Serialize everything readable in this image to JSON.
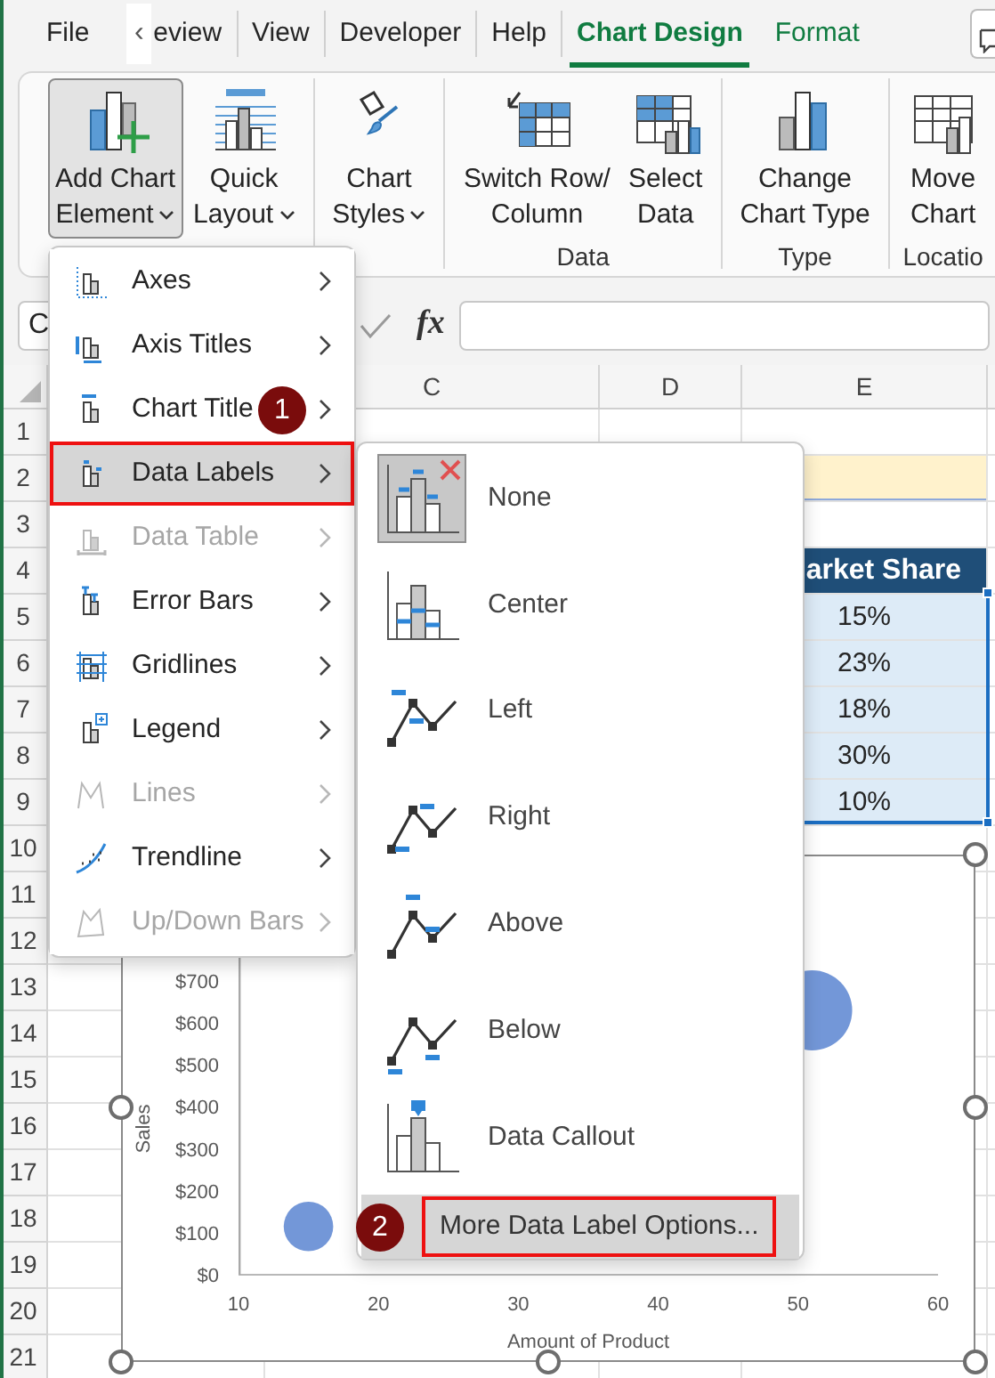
{
  "ribbon_tabs": [
    {
      "label": "File",
      "selected": false,
      "contextual": false
    },
    {
      "label": "eview",
      "selected": false,
      "contextual": false
    },
    {
      "label": "View",
      "selected": false,
      "contextual": false
    },
    {
      "label": "Developer",
      "selected": false,
      "contextual": false
    },
    {
      "label": "Help",
      "selected": false,
      "contextual": false
    },
    {
      "label": "Chart Design",
      "selected": true,
      "contextual": true
    },
    {
      "label": "Format",
      "selected": false,
      "contextual": true
    }
  ],
  "tab_scroll_button": "‹",
  "ribbon_groups": [
    {
      "buttons": [
        {
          "lines": [
            "Add Chart",
            "Element"
          ],
          "dropdown": true,
          "pressed": true
        },
        {
          "lines": [
            "Quick",
            "Layout"
          ],
          "dropdown": true,
          "pressed": false
        }
      ]
    },
    {
      "buttons": [
        {
          "lines": [
            "Chart",
            "Styles"
          ],
          "dropdown": true,
          "pressed": false
        }
      ]
    },
    {
      "label": "Data",
      "buttons": [
        {
          "lines": [
            "Switch Row/",
            "Column"
          ],
          "dropdown": false,
          "pressed": false
        },
        {
          "lines": [
            "Select",
            "Data"
          ],
          "dropdown": false,
          "pressed": false
        }
      ]
    },
    {
      "label": "Type",
      "buttons": [
        {
          "lines": [
            "Change",
            "Chart Type"
          ],
          "dropdown": false,
          "pressed": false
        }
      ]
    },
    {
      "label": "Locatio",
      "buttons": [
        {
          "lines": [
            "Move",
            "Chart"
          ],
          "dropdown": false,
          "pressed": false
        }
      ]
    }
  ],
  "formula_bar": {
    "name_box": "C",
    "function_label": "fx"
  },
  "sheet": {
    "columns": [
      "C",
      "D",
      "E"
    ],
    "rows": [
      "1",
      "2",
      "3",
      "4",
      "5",
      "6",
      "7",
      "8",
      "9",
      "10",
      "11",
      "12",
      "13",
      "14",
      "15",
      "16",
      "17",
      "18",
      "19",
      "20",
      "21"
    ]
  },
  "table": {
    "header": "arket Share",
    "values": [
      "15%",
      "23%",
      "18%",
      "30%",
      "10%"
    ]
  },
  "chart": {
    "chart_data": {
      "type": "scatter",
      "xlabel": "Amount of Product",
      "ylabel": "Sales",
      "x": [
        15,
        51
      ],
      "values": [
        115,
        630
      ],
      "xlim": [
        10,
        60
      ],
      "ylim": [
        0,
        800
      ],
      "xticks": [
        10,
        20,
        30,
        40,
        50,
        60
      ],
      "yticks": [
        {
          "value": 0,
          "label": "$0"
        },
        {
          "value": 100,
          "label": "$100"
        },
        {
          "value": 200,
          "label": "$200"
        },
        {
          "value": 300,
          "label": "$300"
        },
        {
          "value": 400,
          "label": "$400"
        },
        {
          "value": 500,
          "label": "$500"
        },
        {
          "value": 600,
          "label": "$600"
        },
        {
          "value": 700,
          "label": "$700"
        }
      ]
    }
  },
  "chart_element_menu": {
    "items": [
      {
        "label": "Axes",
        "disabled": false,
        "selected": false,
        "outlined": false
      },
      {
        "label": "Axis Titles",
        "disabled": false,
        "selected": false,
        "outlined": false
      },
      {
        "label": "Chart Title",
        "disabled": false,
        "selected": false,
        "outlined": false
      },
      {
        "label": "Data Labels",
        "disabled": false,
        "selected": true,
        "outlined": true
      },
      {
        "label": "Data Table",
        "disabled": true,
        "selected": false,
        "outlined": false
      },
      {
        "label": "Error Bars",
        "disabled": false,
        "selected": false,
        "outlined": false
      },
      {
        "label": "Gridlines",
        "disabled": false,
        "selected": false,
        "outlined": false
      },
      {
        "label": "Legend",
        "disabled": false,
        "selected": false,
        "outlined": false
      },
      {
        "label": "Lines",
        "disabled": true,
        "selected": false,
        "outlined": false
      },
      {
        "label": "Trendline",
        "disabled": false,
        "selected": false,
        "outlined": false
      },
      {
        "label": "Up/Down Bars",
        "disabled": true,
        "selected": false,
        "outlined": false
      }
    ]
  },
  "data_labels_submenu": {
    "items": [
      {
        "label": "None",
        "selected": true
      },
      {
        "label": "Center",
        "selected": false
      },
      {
        "label": "Left",
        "selected": false
      },
      {
        "label": "Right",
        "selected": false
      },
      {
        "label": "Above",
        "selected": false
      },
      {
        "label": "Below",
        "selected": false
      },
      {
        "label": "Data Callout",
        "selected": false
      }
    ],
    "more_options": {
      "label": "More Data Label Options...",
      "highlighted": true,
      "outlined": true
    }
  },
  "step_badges": [
    "1",
    "2"
  ]
}
